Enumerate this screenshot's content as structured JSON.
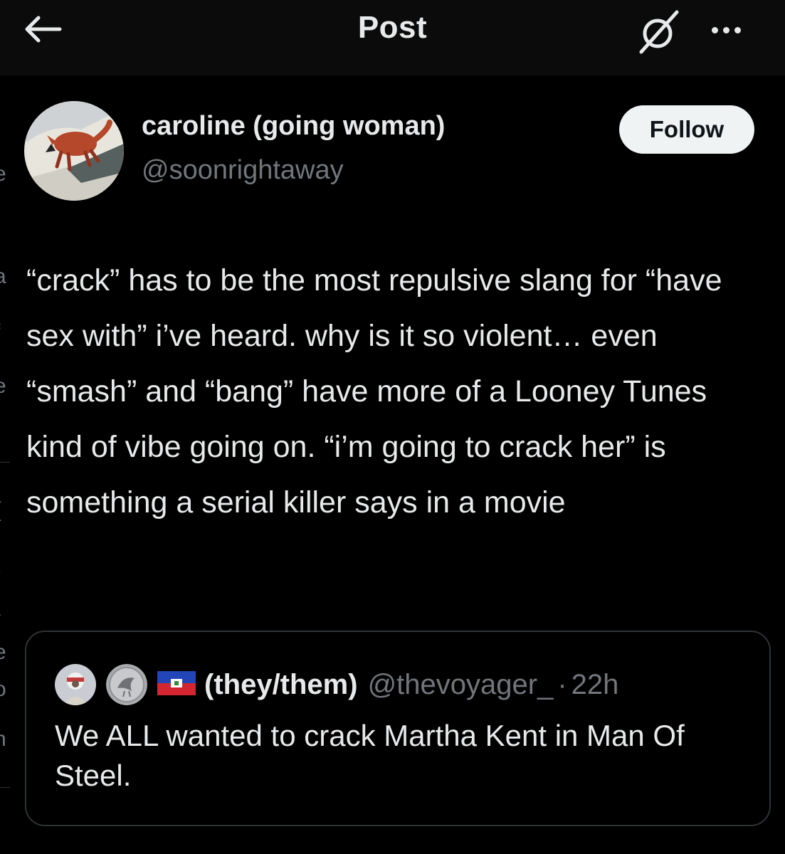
{
  "header": {
    "title": "Post",
    "back_icon": "arrow-left-icon",
    "grok_icon": "grok-slash-icon",
    "more_icon": "more-horizontal-icon"
  },
  "post": {
    "author_name": "caroline (going woman)",
    "author_handle": "@soonrightaway",
    "follow_label": "Follow",
    "text": "“crack” has to be the most repulsive slang for “have sex with” i’ve heard. why is it so violent… even “smash” and “bang” have more of a Looney Tunes kind of vibe going on. “i’m going to crack her” is something a serial killer says in a movie"
  },
  "quote": {
    "name": "(they/them)",
    "handle": "@thevoyager_",
    "separator": "·",
    "time": "22h",
    "text": "We ALL wanted to crack Martha Kent in Man Of Steel."
  },
  "colors": {
    "background": "#000000",
    "header_bg": "#0b0b0b",
    "text_primary": "#e7e9ea",
    "text_secondary": "#71767b",
    "border": "#2f3336",
    "follow_bg": "#eff3f4"
  }
}
